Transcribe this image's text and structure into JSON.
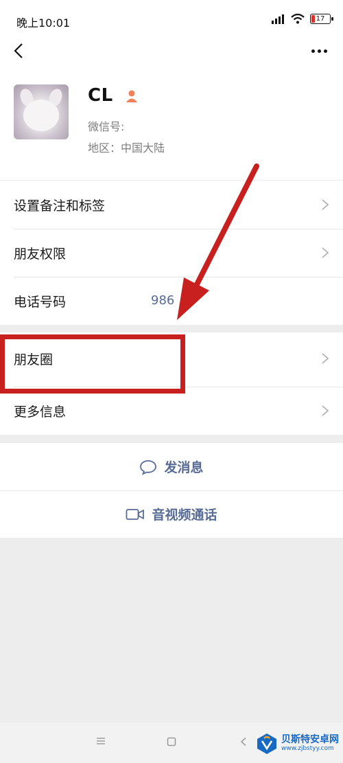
{
  "status_bar": {
    "time": "晚上10:01",
    "battery": "17"
  },
  "profile": {
    "name": "CL",
    "wechat_id_label": "微信号:",
    "region": "地区：中国大陆"
  },
  "settings_group": [
    {
      "label": "设置备注和标签"
    },
    {
      "label": "朋友权限"
    },
    {
      "label": "电话号码",
      "value": "986"
    }
  ],
  "moments_group": [
    {
      "label": "朋友圈"
    },
    {
      "label": "更多信息"
    }
  ],
  "actions": {
    "message": "发消息",
    "video_call": "音视频通话"
  },
  "watermark": {
    "main": "贝斯特安卓网",
    "sub": "www.zjbstyy.com"
  },
  "colors": {
    "accent_link": "#576b95",
    "annotation": "#c8201f",
    "gender_female": "#f0825a"
  }
}
